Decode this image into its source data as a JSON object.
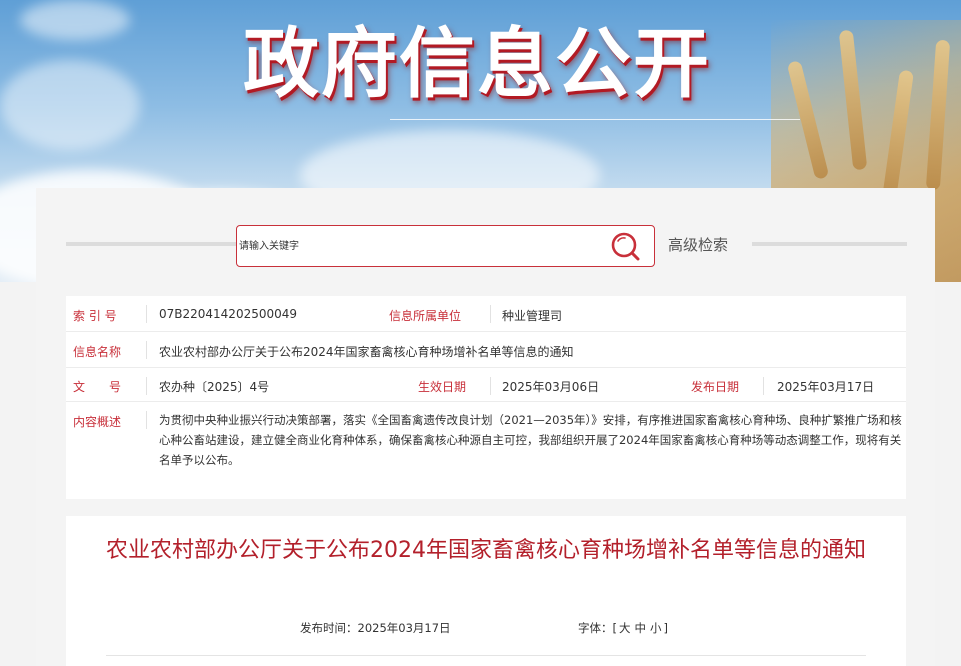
{
  "banner": {
    "title": "政府信息公开"
  },
  "search": {
    "placeholder": "请输入关键字",
    "advanced_label": "高级检索"
  },
  "info_table": {
    "index_label": "索 引 号",
    "index_value": "07B220414202500049",
    "unit_label": "信息所属单位",
    "unit_value": "种业管理司",
    "name_label": "信息名称",
    "name_value": "农业农村部办公厅关于公布2024年国家畜禽核心育种场增补名单等信息的通知",
    "doc_label": "文　　号",
    "doc_value": "农办种〔2025〕4号",
    "effective_label": "生效日期",
    "effective_value": "2025年03月06日",
    "publish_label": "发布日期",
    "publish_value": "2025年03月17日",
    "summary_label": "内容概述",
    "summary_value": "为贯彻中央种业振兴行动决策部署，落实《全国畜禽遗传改良计划（2021—2035年）》安排，有序推进国家畜禽核心育种场、良种扩繁推广场和核心种公畜站建设，建立健全商业化育种体系，确保畜禽核心种源自主可控，我部组织开展了2024年国家畜禽核心育种场等动态调整工作，现将有关名单予以公布。"
  },
  "article": {
    "title": "农业农村部办公厅关于公布2024年国家畜禽核心育种场增补名单等信息的通知",
    "publish_time_label": "发布时间：",
    "publish_time_value": "2025年03月17日",
    "font_label": "字体：",
    "font_bracket_open": "[",
    "font_large": "大",
    "font_medium": "中",
    "font_small": "小",
    "font_bracket_close": "]"
  },
  "colors": {
    "accent_red": "#c8303a",
    "title_red": "#b3202b",
    "text": "#333333"
  },
  "icons": {
    "search": "search-icon"
  }
}
